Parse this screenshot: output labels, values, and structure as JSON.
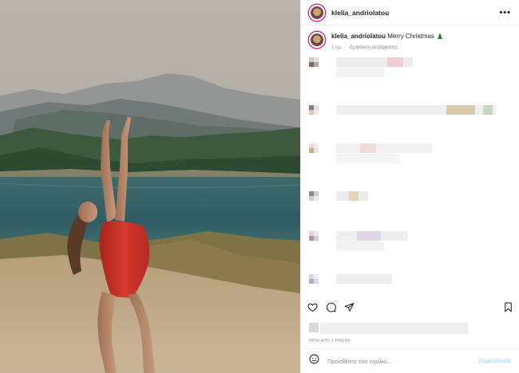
{
  "header": {
    "username": "klelia_andriolatou",
    "more_label": "•••"
  },
  "caption": {
    "username": "klelia_andriolatou",
    "text": "Merry Christmas",
    "time": "1 ημ.",
    "see_translation": "Εμφάνιση μετάφρασης"
  },
  "actions": {
    "like_icon": "heart-icon",
    "comment_icon": "comment-icon",
    "share_icon": "share-icon",
    "save_icon": "bookmark-icon"
  },
  "post_date": "ΠΡΙΝ ΑΠΟ 1 ΗΜΕΡΑ",
  "add_comment": {
    "placeholder": "Προσθέστε ένα σχόλιο...",
    "post_label": "Δημοσίευση",
    "emoji_icon": "smiley-icon"
  },
  "colors": {
    "swimsuit": "#d33a2c",
    "lake": "#2f5d62",
    "link_disabled": "#b3dbff"
  }
}
